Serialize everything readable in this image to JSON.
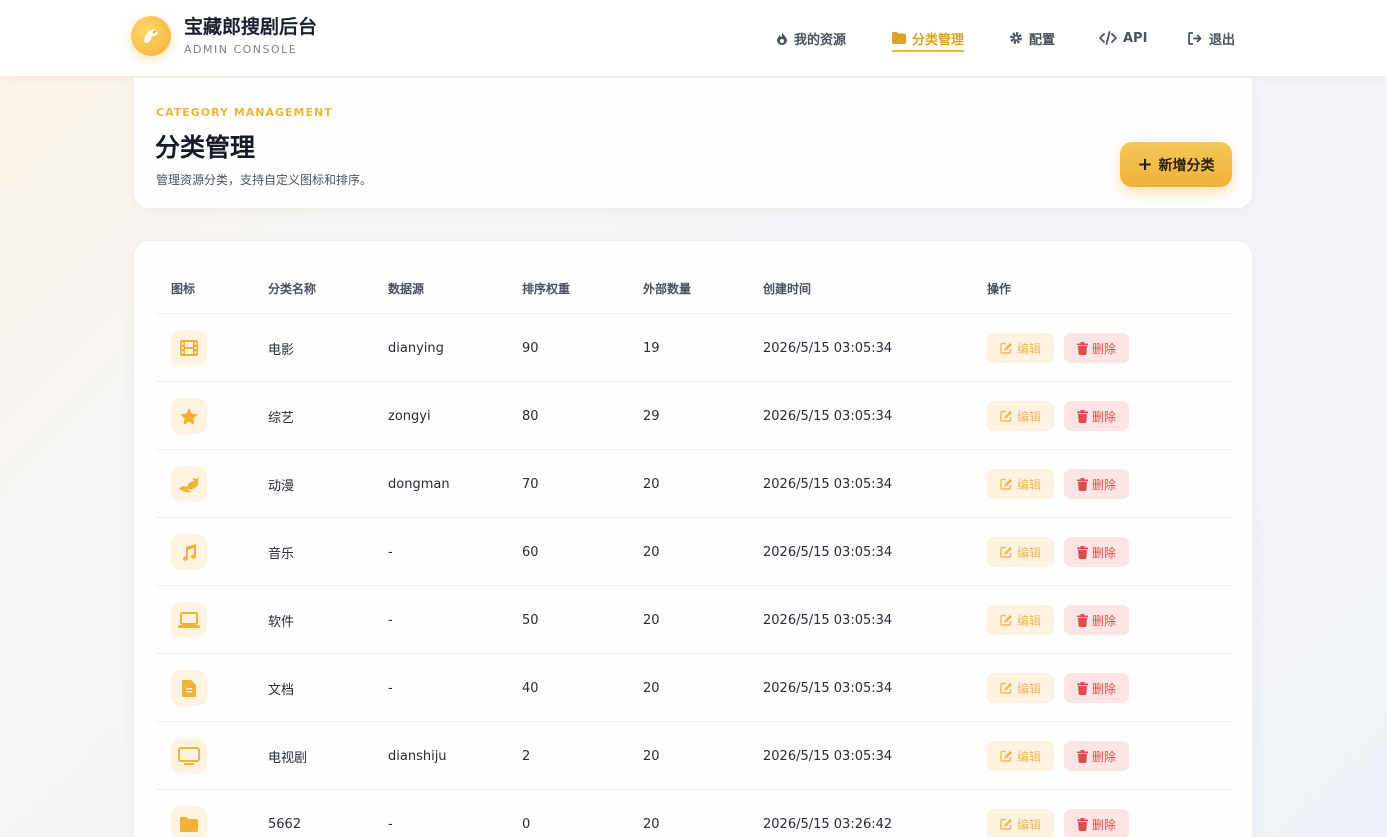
{
  "brand": {
    "title": "宝藏郎搜剧后台",
    "subtitle": "ADMIN CONSOLE"
  },
  "nav": [
    {
      "label": "我的资源",
      "icon": "fire-icon",
      "active": false
    },
    {
      "label": "分类管理",
      "icon": "folder-icon",
      "active": true
    },
    {
      "label": "配置",
      "icon": "gear-icon",
      "active": false
    },
    {
      "label": "API",
      "icon": "code-icon",
      "active": false
    },
    {
      "label": "退出",
      "icon": "logout-icon",
      "active": false
    }
  ],
  "page": {
    "eyebrow": "CATEGORY MANAGEMENT",
    "title": "分类管理",
    "description": "管理资源分类，支持自定义图标和排序。",
    "add_button": "新增分类"
  },
  "table": {
    "columns": [
      "图标",
      "分类名称",
      "数据源",
      "排序权重",
      "外部数量",
      "创建时间",
      "操作"
    ],
    "edit_label": "编辑",
    "delete_label": "删除",
    "rows": [
      {
        "icon": "film-icon",
        "name": "电影",
        "source": "dianying",
        "weight": "90",
        "count": "19",
        "created": "2026/5/15 03:05:34"
      },
      {
        "icon": "star-icon",
        "name": "综艺",
        "source": "zongyi",
        "weight": "80",
        "count": "29",
        "created": "2026/5/15 03:05:34"
      },
      {
        "icon": "dragon-icon",
        "name": "动漫",
        "source": "dongman",
        "weight": "70",
        "count": "20",
        "created": "2026/5/15 03:05:34"
      },
      {
        "icon": "music-icon",
        "name": "音乐",
        "source": "-",
        "weight": "60",
        "count": "20",
        "created": "2026/5/15 03:05:34"
      },
      {
        "icon": "laptop-icon",
        "name": "软件",
        "source": "-",
        "weight": "50",
        "count": "20",
        "created": "2026/5/15 03:05:34"
      },
      {
        "icon": "document-icon",
        "name": "文档",
        "source": "-",
        "weight": "40",
        "count": "20",
        "created": "2026/5/15 03:05:34"
      },
      {
        "icon": "tv-icon",
        "name": "电视剧",
        "source": "dianshiju",
        "weight": "2",
        "count": "20",
        "created": "2026/5/15 03:05:34"
      },
      {
        "icon": "folder-icon",
        "name": "5662",
        "source": "-",
        "weight": "0",
        "count": "20",
        "created": "2026/5/15 03:26:42"
      }
    ]
  },
  "colors": {
    "accent": "#f0b336",
    "danger": "#e04b4b",
    "icon_bg": "#fdf3e0"
  }
}
